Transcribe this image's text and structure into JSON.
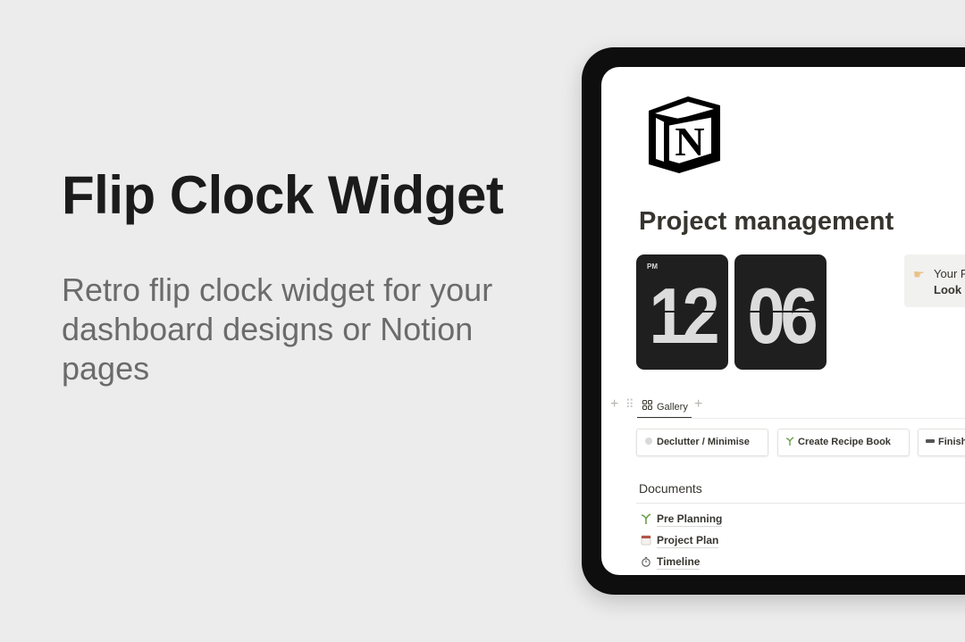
{
  "hero": {
    "title": "Flip Clock Widget",
    "subtitle": "Retro flip clock widget for your dashboard designs or Notion pages"
  },
  "notion_page": {
    "logo_icon": "notion-logo-icon",
    "title": "Project management",
    "clock": {
      "hour": "12",
      "minute": "06",
      "period": "PM"
    },
    "callout": {
      "icon": "pointing-hand-icon",
      "line1": "Your P",
      "line2": "Look a"
    },
    "views": {
      "add_label": "+",
      "tabs": [
        {
          "label": "Gallery",
          "icon": "gallery-grid-icon",
          "active": true
        }
      ],
      "add_view_label": "+"
    },
    "gallery_cards": [
      {
        "label": "Declutter / Minimise",
        "icon": "grey-circle-icon"
      },
      {
        "label": "Create Recipe Book",
        "icon": "sprout-icon"
      },
      {
        "label": "Finish",
        "icon": "keyboard-icon"
      }
    ],
    "documents": {
      "heading": "Documents",
      "items": [
        {
          "label": "Pre Planning",
          "icon": "sprout-icon"
        },
        {
          "label": "Project Plan",
          "icon": "calendar-icon"
        },
        {
          "label": "Timeline",
          "icon": "stopwatch-icon"
        }
      ]
    }
  },
  "colors": {
    "background": "#ececec",
    "title_text": "#1b1b1b",
    "subtitle_text": "#6b6b6b",
    "device_frame": "#0e0e0e",
    "flip_card": "#1f1f1f",
    "flip_digits": "#dcdcdc",
    "callout_bg": "#f1f1ef",
    "sprout_green": "#6a9f4a"
  }
}
